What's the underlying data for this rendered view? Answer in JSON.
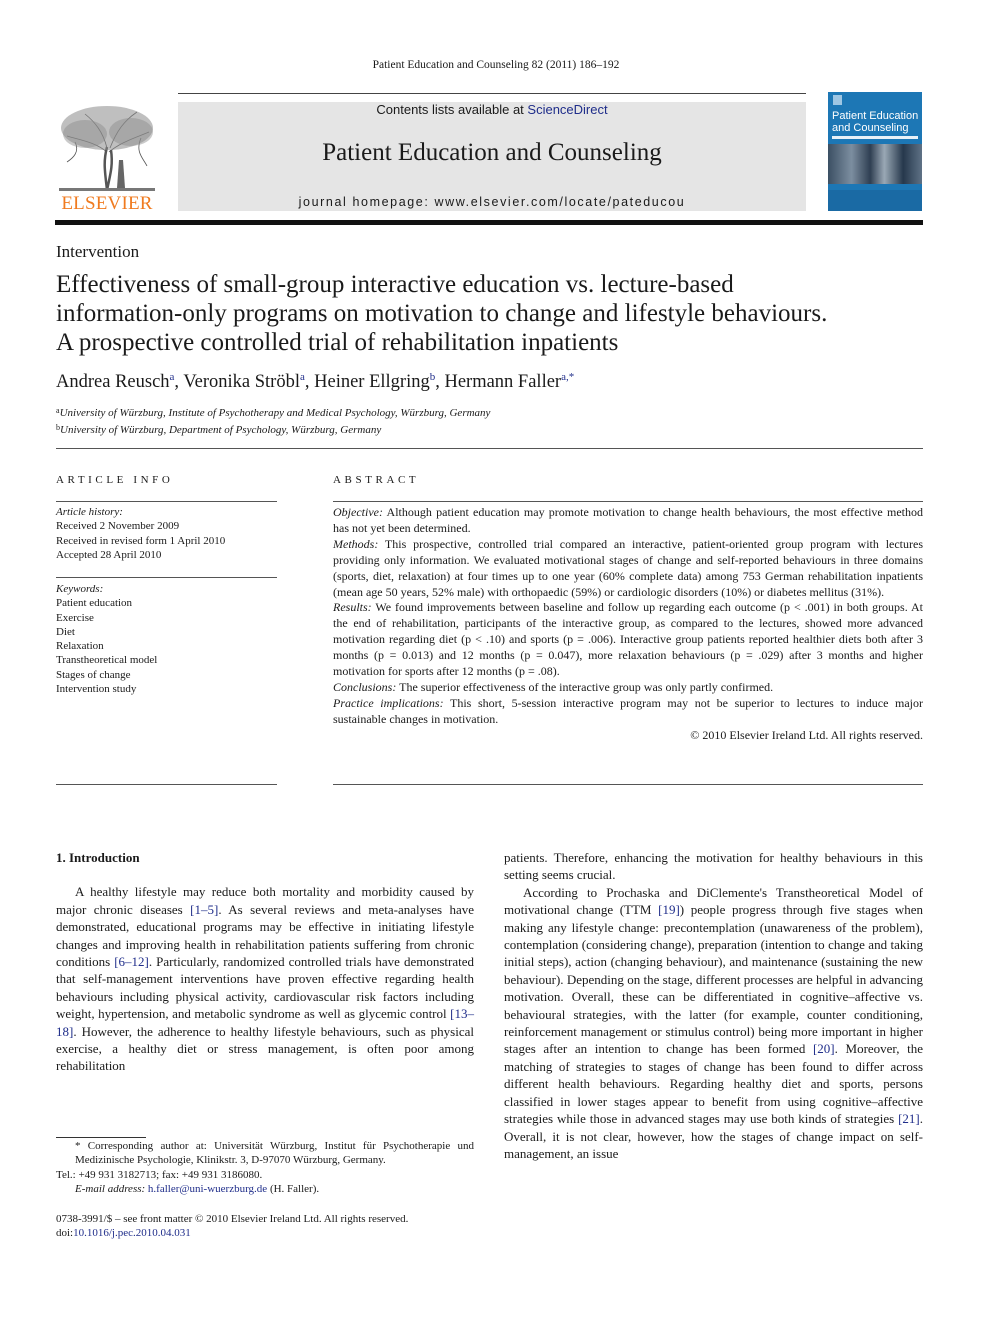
{
  "running_head": "Patient Education and Counseling 82 (2011) 186–192",
  "header": {
    "contents_prefix": "Contents lists available at ",
    "contents_link": "ScienceDirect",
    "journal_title": "Patient Education and Counseling",
    "homepage": "journal homepage: www.elsevier.com/locate/pateducou",
    "publisher_logo_text": "ELSEVIER",
    "cover": {
      "title_line1": "Patient Education",
      "title_line2": "and Counseling"
    },
    "colors": {
      "elsevier_orange": "#f07b20",
      "link_blue": "#1f2d8a",
      "banner_gray": "#e5e5e5",
      "cover_blue": "#1d77b5"
    }
  },
  "article": {
    "section": "Intervention",
    "title_lines": [
      "Effectiveness of small-group interactive education vs. lecture-based",
      "information-only programs on motivation to change and lifestyle behaviours.",
      "A prospective controlled trial of rehabilitation inpatients"
    ],
    "authors": [
      {
        "name": "Andrea Reusch",
        "sup": "a",
        "sep": ", "
      },
      {
        "name": "Veronika Ströbl",
        "sup": "a",
        "sep": ", "
      },
      {
        "name": "Heiner Ellgring",
        "sup": "b",
        "sep": ", "
      },
      {
        "name": "Hermann Faller",
        "sup": "a,*",
        "sep": ""
      }
    ],
    "affiliations": [
      {
        "sup": "a",
        "text": "University of Würzburg, Institute of Psychotherapy and Medical Psychology, Würzburg, Germany"
      },
      {
        "sup": "b",
        "text": "University of Würzburg, Department of Psychology, Würzburg, Germany"
      }
    ]
  },
  "article_info": {
    "heading": "ARTICLE INFO",
    "history_label": "Article history:",
    "history": [
      "Received 2 November 2009",
      "Received in revised form 1 April 2010",
      "Accepted 28 April 2010"
    ],
    "keywords_label": "Keywords:",
    "keywords": [
      "Patient education",
      "Exercise",
      "Diet",
      "Relaxation",
      "Transtheoretical model",
      "Stages of change",
      "Intervention study"
    ]
  },
  "abstract": {
    "heading": "ABSTRACT",
    "sections": [
      {
        "label": "Objective:",
        "text": " Although patient education may promote motivation to change health behaviours, the most effective method has not yet been determined."
      },
      {
        "label": "Methods:",
        "text": " This prospective, controlled trial compared an interactive, patient-oriented group program with lectures providing only information. We evaluated motivational stages of change and self-reported behaviours in three domains (sports, diet, relaxation) at four times up to one year (60% complete data) among 753 German rehabilitation inpatients (mean age 50 years, 52% male) with orthopaedic (59%) or cardiologic disorders (10%) or diabetes mellitus (31%)."
      },
      {
        "label": "Results:",
        "text": " We found improvements between baseline and follow up regarding each outcome (p < .001) in both groups. At the end of rehabilitation, participants of the interactive group, as compared to the lectures, showed more advanced motivation regarding diet (p < .10) and sports (p = .006). Interactive group patients reported healthier diets both after 3 months (p = 0.013) and 12 months (p = 0.047), more relaxation behaviours (p = .029) after 3 months and higher motivation for sports after 12 months (p = .08)."
      },
      {
        "label": "Conclusions:",
        "text": " The superior effectiveness of the interactive group was only partly confirmed."
      },
      {
        "label": "Practice implications:",
        "text": " This short, 5-session interactive program may not be superior to lectures to induce major sustainable changes in motivation."
      }
    ],
    "copyright": "© 2010 Elsevier Ireland Ltd. All rights reserved."
  },
  "body": {
    "intro_heading": "1.  Introduction",
    "left_paragraph": [
      {
        "t": "A healthy lifestyle may reduce both mortality and morbidity caused by major chronic diseases "
      },
      {
        "ref": "[1–5]"
      },
      {
        "t": ". As several reviews and meta-analyses have demonstrated, educational programs may be effective in initiating lifestyle changes and improving health in rehabilitation patients suffering from chronic conditions "
      },
      {
        "ref": "[6–12]"
      },
      {
        "t": ". Particularly, randomized controlled trials have demonstrated that self-management interventions have proven effective regarding health behaviours including physical activity, cardiovascular risk factors including weight, hypertension, and metabolic syndrome as well as glycemic control "
      },
      {
        "ref": "[13–18]"
      },
      {
        "t": ". However, the adherence to healthy lifestyle behaviours, such as physical exercise, a healthy diet or stress management, is often poor among rehabilitation"
      }
    ],
    "right_continuation": "patients. Therefore, enhancing the motivation for healthy behaviours in this setting seems crucial.",
    "right_paragraph": [
      {
        "t": "According to Prochaska and DiClemente's Transtheoretical Model of motivational change (TTM "
      },
      {
        "ref": "[19]"
      },
      {
        "t": ") people progress through five stages when making any lifestyle change: precontemplation (unawareness of the problem), contemplation (considering change), preparation (intention to change and taking initial steps), action (changing behaviour), and maintenance (sustaining the new behaviour). Depending on the stage, different processes are helpful in advancing motivation. Overall, these can be differentiated in cognitive–affective vs. behavioural strategies, with the latter (for example, counter conditioning, reinforcement management or stimulus control) being more important in higher stages after an intention to change has been formed "
      },
      {
        "ref": "[20]"
      },
      {
        "t": ". Moreover, the matching of strategies to stages of change has been found to differ across different health behaviours. Regarding healthy diet and sports, persons classified in lower stages appear to benefit from using cognitive–affective strategies while those in advanced stages may use both kinds of strategies "
      },
      {
        "ref": "[21]"
      },
      {
        "t": ". Overall, it is not clear, however, how the stages of change impact on self-management, an issue"
      }
    ]
  },
  "footnotes": {
    "corresponding": "* Corresponding author at: Universität Würzburg, Institut für Psychotherapie und Medizinische Psychologie, Klinikstr. 3, D-97070 Würzburg, Germany.",
    "tel_fax": "Tel.: +49 931 3182713; fax: +49 931 3186080.",
    "email_label": "E-mail address:",
    "email": "h.faller@uni-wuerzburg.de",
    "email_suffix": " (H. Faller).",
    "issn_line": "0738-3991/$ – see front matter © 2010 Elsevier Ireland Ltd. All rights reserved.",
    "doi_prefix": "doi:",
    "doi": "10.1016/j.pec.2010.04.031"
  }
}
